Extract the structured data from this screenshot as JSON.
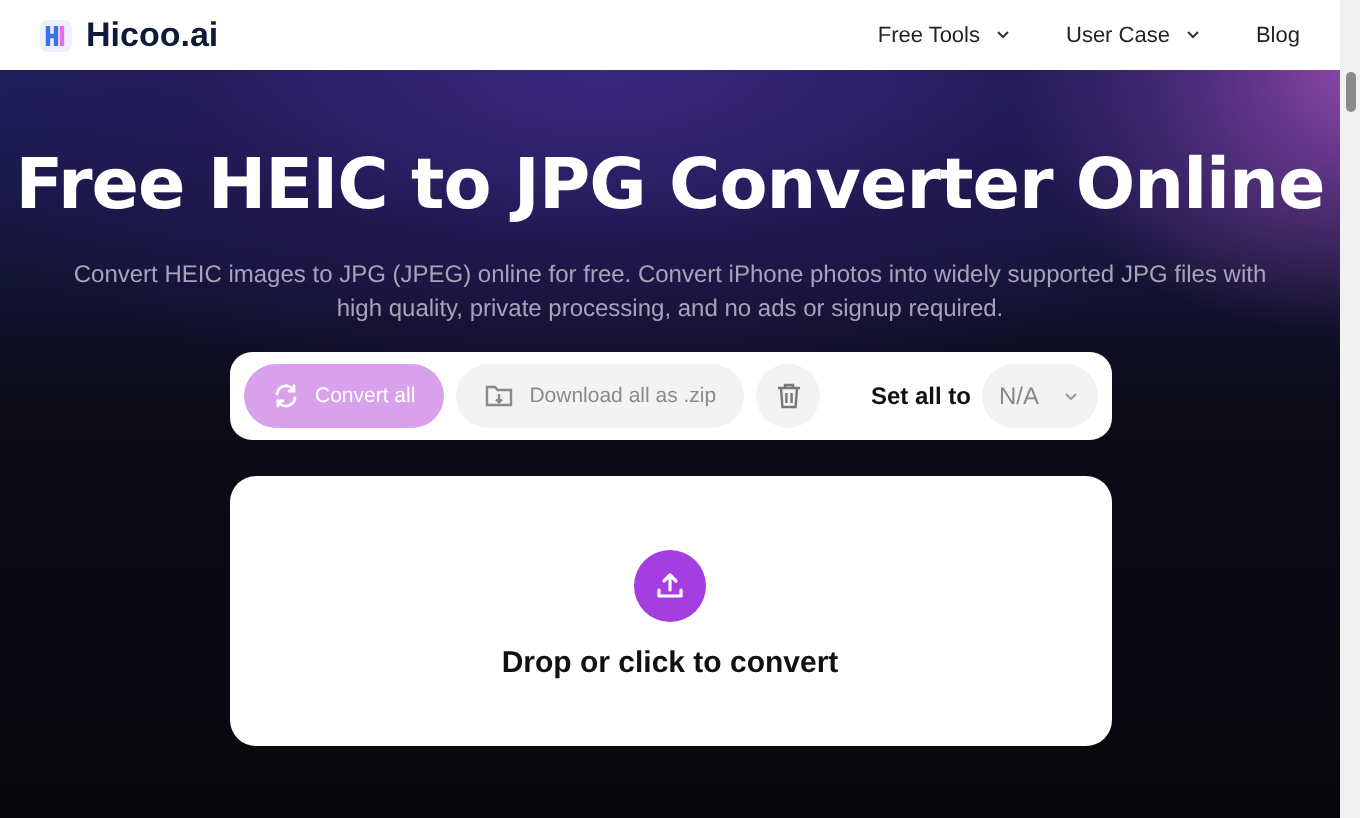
{
  "header": {
    "logo": "Hicoo.ai",
    "nav": [
      {
        "label": "Free Tools",
        "dropdown": true
      },
      {
        "label": "User Case",
        "dropdown": true
      },
      {
        "label": "Blog",
        "dropdown": false
      }
    ]
  },
  "hero": {
    "title": "Free HEIC to JPG Converter Online",
    "subtitle": "Convert HEIC images to JPG (JPEG) online for free. Convert iPhone photos into widely supported JPG files with high quality, private processing, and no ads or signup required."
  },
  "toolbar": {
    "convert": {
      "label": "Convert all",
      "disabled": true
    },
    "download": {
      "label": "Download all as .zip",
      "disabled": true
    },
    "delete": {
      "disabled": true
    },
    "set_all_label": "Set all to",
    "format": "N/A"
  },
  "dropzone": {
    "label": "Drop or click to convert"
  }
}
